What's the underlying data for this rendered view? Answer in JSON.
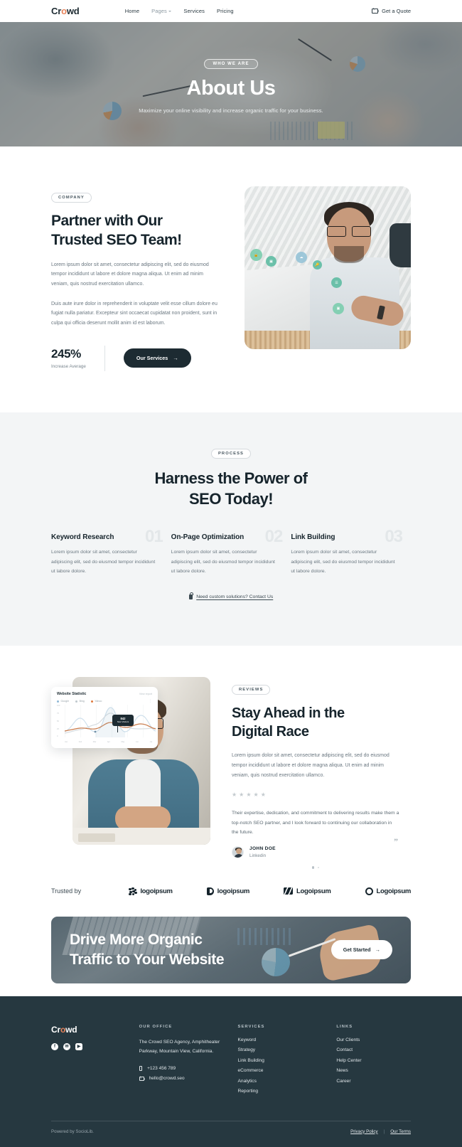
{
  "header": {
    "logo": "Cr",
    "logo_accent": "o",
    "logo_tail": "wd",
    "nav": [
      {
        "label": "Home",
        "active": false,
        "caret": false
      },
      {
        "label": "Pages",
        "active": true,
        "caret": true
      },
      {
        "label": "Services",
        "active": false,
        "caret": false
      },
      {
        "label": "Pricing",
        "active": false,
        "caret": false
      }
    ],
    "quote_label": "Get a Quote"
  },
  "hero": {
    "badge": "WHO WE ARE",
    "title": "About Us",
    "subtitle": "Maximize your online visibility and increase organic traffic for your business."
  },
  "partner": {
    "badge": "COMPANY",
    "title_line1": "Partner with Our",
    "title_line2": "Trusted SEO Team!",
    "paragraph1": "Lorem ipsum dolor sit amet, consectetur adipiscing elit, sed do eiusmod tempor incididunt ut labore et dolore magna aliqua. Ut enim ad minim veniam, quis nostrud exercitation ullamco.",
    "paragraph2": "Duis aute irure dolor in reprehenderit in voluptate velit esse cillum dolore eu fugiat nulla pariatur. Excepteur sint occaecat cupidatat non proident, sunt in culpa qui officia deserunt mollit anim id est laborum.",
    "stat_value": "245%",
    "stat_label": "Increase Average",
    "button_label": "Our Services",
    "button_arrow": "→"
  },
  "process": {
    "badge": "PROCESS",
    "title_line1": "Harness the Power of",
    "title_line2": "SEO Today!",
    "steps": [
      {
        "index": "01",
        "title": "Keyword Research",
        "text": "Lorem ipsum dolor sit amet, consectetur adipiscing elit, sed do eiusmod tempor incididunt ut labore dolore."
      },
      {
        "index": "02",
        "title": "On-Page Optimization",
        "text": "Lorem ipsum dolor sit amet, consectetur adipiscing elit, sed do eiusmod tempor incididunt ut labore dolore."
      },
      {
        "index": "03",
        "title": "Link Building",
        "text": "Lorem ipsum dolor sit amet, consectetur adipiscing elit, sed do eiusmod tempor incididunt ut labore dolore."
      }
    ],
    "contact_link": "Need custom solutions? Contact Us"
  },
  "reviews": {
    "badge": "REVIEWS",
    "title_line1": "Stay Ahead in the",
    "title_line2": "Digital Race",
    "intro": "Lorem ipsum dolor sit amet, consectetur adipiscing elit, sed do eiusmod tempor incididunt ut labore et dolore magna aliqua. Ut enim ad minim veniam, quis nostrud exercitation ullamco.",
    "rating": 5,
    "quote": "Their expertise, dedication, and commitment to delivering results make them a top-notch SEO partner, and I look forward to continuing our collaboration in the future.",
    "author_name": "JOHN DOE",
    "author_role": "Linkedin",
    "quote_mark": "”"
  },
  "stat_card": {
    "title": "Website Statistic",
    "link": "View report",
    "legend": [
      {
        "label": "Google",
        "color": "#8fb9d6"
      },
      {
        "label": "Bing",
        "color": "#bfc8cd"
      },
      {
        "label": "Yahoo",
        "color": "#e07a3f"
      }
    ],
    "y_labels": [
      "100",
      "75",
      "50",
      "25",
      "0"
    ],
    "x_labels": [
      "Jan",
      "Feb",
      "Mar",
      "Apr",
      "May",
      "Jun",
      "Jul"
    ],
    "tooltip_value": "842",
    "tooltip_label": "New Visitors",
    "menu_icon": "kebab-menu"
  },
  "chart_data": {
    "type": "line",
    "title": "Website Statistic",
    "x": [
      "Jan",
      "Feb",
      "Mar",
      "Apr",
      "May",
      "Jun",
      "Jul"
    ],
    "xlabel": "",
    "ylabel": "",
    "ylim": [
      0,
      100
    ],
    "grid": true,
    "legend_position": "top-left",
    "series": [
      {
        "name": "Google",
        "color": "#8fb9d6",
        "values": [
          18,
          62,
          16,
          92,
          20,
          70,
          22
        ]
      },
      {
        "name": "Bing",
        "color": "#bfc8cd",
        "values": [
          14,
          20,
          30,
          74,
          34,
          24,
          28
        ]
      },
      {
        "name": "Yahoo",
        "color": "#c97a4a",
        "values": [
          20,
          26,
          22,
          46,
          28,
          40,
          24
        ]
      }
    ],
    "annotation": {
      "x": "Apr",
      "value": "842",
      "label": "New Visitors"
    }
  },
  "trusted": {
    "label": "Trusted by",
    "logos": [
      {
        "name": "logoipsum",
        "mark": "dots-mark"
      },
      {
        "name": "logoipsum",
        "mark": "half-circle-mark"
      },
      {
        "name": "Logoipsum",
        "mark": "stripes-mark"
      },
      {
        "name": "Logoipsum",
        "mark": "ring-mark"
      }
    ]
  },
  "cta": {
    "title_line1": "Drive More Organic",
    "title_line2": "Traffic to Your Website",
    "button_label": "Get Started",
    "button_arrow": "→"
  },
  "footer": {
    "logo": "Cr",
    "logo_accent": "o",
    "logo_tail": "wd",
    "socials": [
      {
        "name": "facebook",
        "glyph": "f"
      },
      {
        "name": "twitter",
        "glyph": "✉"
      },
      {
        "name": "youtube",
        "glyph": "▶"
      }
    ],
    "office": {
      "heading": "OUR OFFICE",
      "address": "The Crowd SEO Agency, Amphitheater Parkway, Mountain View, California.",
      "phone": "+123 456 789",
      "email": "hello@crowd.seo"
    },
    "services": {
      "heading": "SERVICES",
      "items": [
        "Keyword",
        "Strategy",
        "Link Building",
        "eCommerce",
        "Analytics",
        "Reporting"
      ]
    },
    "links": {
      "heading": "LINKS",
      "items": [
        "Our Clients",
        "Contact",
        "Help Center",
        "News",
        "Career"
      ]
    },
    "powered_prefix": "Powered by ",
    "powered_brand": "SocioLib.",
    "privacy": "Privacy Policy",
    "separator": "|",
    "terms": "Our Terms"
  }
}
